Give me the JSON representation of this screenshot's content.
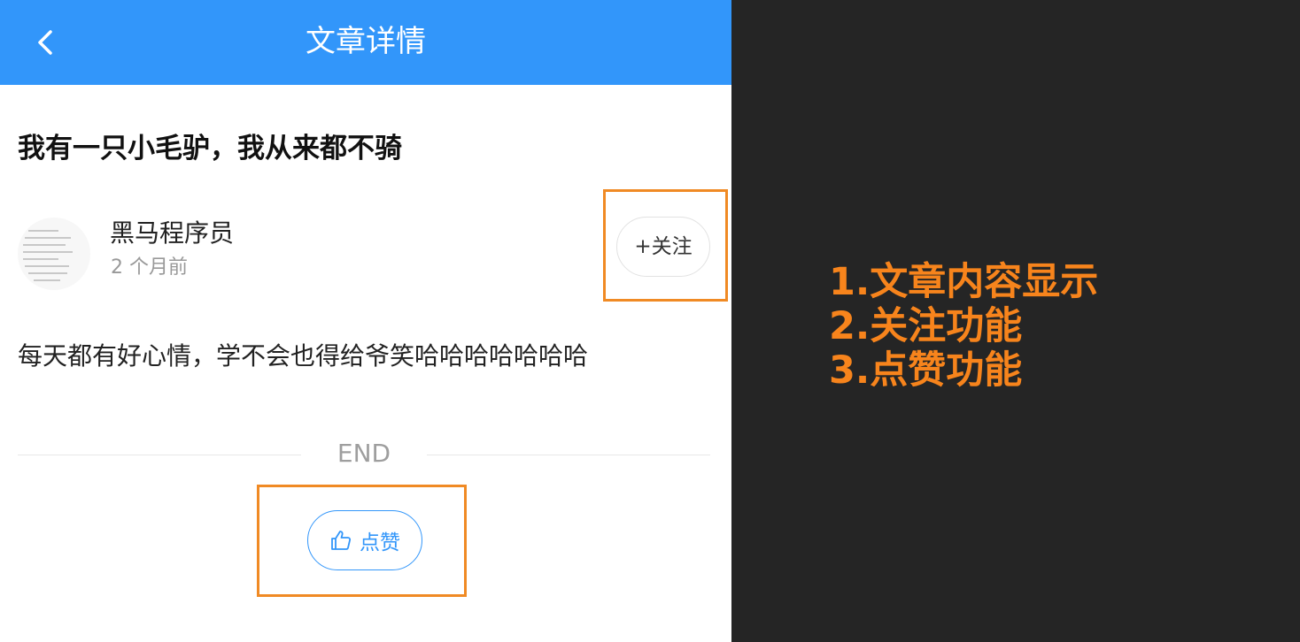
{
  "header": {
    "title": "文章详情"
  },
  "article": {
    "title": "我有一只小毛驴，我从来都不骑",
    "author": "黑马程序员",
    "time": "2 个月前",
    "follow_label": "+关注",
    "content": "每天都有好心情，学不会也得给爷笑哈哈哈哈哈哈哈",
    "end_label": "END",
    "like_label": "点赞"
  },
  "notes": [
    "1.文章内容显示",
    "2.关注功能",
    "3.点赞功能"
  ],
  "colors": {
    "primary": "#3296fa",
    "highlight": "#f08a24",
    "note_text": "#f7841c",
    "right_bg": "#252525"
  }
}
